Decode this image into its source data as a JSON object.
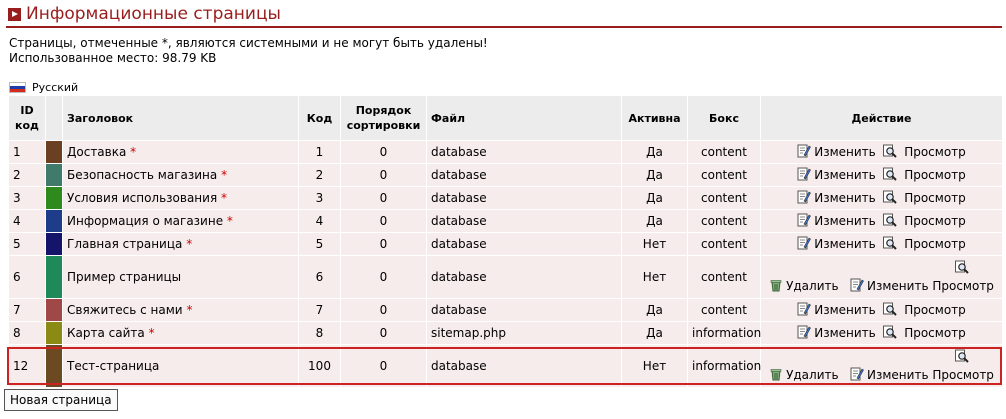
{
  "header": {
    "title": "Информационные страницы"
  },
  "notice": {
    "line1": "Страницы, отмеченные *, являются системными и не могут быть удалены!",
    "line2": "Использованное место: 98.79 KB"
  },
  "language": {
    "label": "Русский",
    "flag_colors": [
      "#ffffff",
      "#1c3fa8",
      "#d52b1e"
    ]
  },
  "columns": {
    "id": "ID код",
    "title": "Заголовок",
    "code": "Код",
    "sort": "Порядок сортировки",
    "file": "Файл",
    "active": "Активна",
    "box": "Бокс",
    "action": "Действие"
  },
  "actions": {
    "delete": "Удалить",
    "edit": "Изменить",
    "view": "Просмотр"
  },
  "rows": [
    {
      "id": "1",
      "color": "#6b3f22",
      "title": "Доставка",
      "star": "*",
      "code": "1",
      "sort": "0",
      "file": "database",
      "active": "Да",
      "box": "content",
      "deletable": false
    },
    {
      "id": "2",
      "color": "#3f7a6b",
      "title": "Безопасность магазина",
      "star": "*",
      "code": "2",
      "sort": "0",
      "file": "database",
      "active": "Да",
      "box": "content",
      "deletable": false
    },
    {
      "id": "3",
      "color": "#2f8a1e",
      "title": "Условия использования",
      "star": "*",
      "code": "3",
      "sort": "0",
      "file": "database",
      "active": "Да",
      "box": "content",
      "deletable": false
    },
    {
      "id": "4",
      "color": "#1e3c8a",
      "title": "Информация о магазине",
      "star": "*",
      "code": "4",
      "sort": "0",
      "file": "database",
      "active": "Да",
      "box": "content",
      "deletable": false
    },
    {
      "id": "5",
      "color": "#14146b",
      "title": "Главная страница",
      "star": "*",
      "code": "5",
      "sort": "0",
      "file": "database",
      "active": "Нет",
      "box": "content",
      "deletable": false
    },
    {
      "id": "6",
      "color": "#1e8a5a",
      "title": "Пример страницы",
      "star": "",
      "code": "6",
      "sort": "0",
      "file": "database",
      "active": "Нет",
      "box": "content",
      "deletable": true
    },
    {
      "id": "7",
      "color": "#a04848",
      "title": "Свяжитесь с нами",
      "star": "*",
      "code": "7",
      "sort": "0",
      "file": "database",
      "active": "Да",
      "box": "content",
      "deletable": false
    },
    {
      "id": "8",
      "color": "#8a8a14",
      "title": "Карта сайта",
      "star": "*",
      "code": "8",
      "sort": "0",
      "file": "sitemap.php",
      "active": "Да",
      "box": "information",
      "deletable": false
    },
    {
      "id": "12",
      "color": "#6b4a22",
      "title": "Тест-страница",
      "star": "",
      "code": "100",
      "sort": "0",
      "file": "database",
      "active": "Нет",
      "box": "information",
      "deletable": true,
      "selected": true
    }
  ],
  "new_page_button": "Новая страница"
}
